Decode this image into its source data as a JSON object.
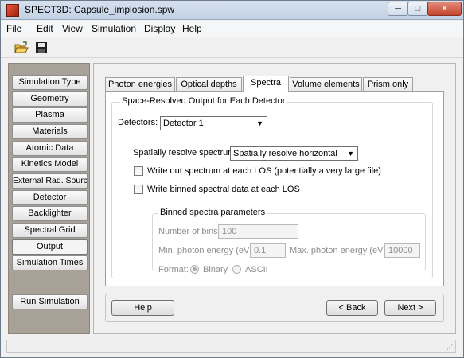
{
  "window": {
    "title": "SPECT3D:  Capsule_implosion.spw",
    "minimize_glyph": "─",
    "maximize_glyph": "□",
    "close_glyph": "✕"
  },
  "menu": {
    "items": [
      {
        "hotkey": "F",
        "rest": "ile"
      },
      {
        "hotkey": "E",
        "rest": "dit"
      },
      {
        "hotkey": "V",
        "rest": "iew"
      },
      {
        "pre": "Si",
        "hotkey": "m",
        "rest": "ulation"
      },
      {
        "hotkey": "D",
        "rest": "isplay"
      },
      {
        "hotkey": "H",
        "rest": "elp"
      }
    ]
  },
  "toolbar": {
    "icons": [
      "open-folder-icon",
      "save-disk-icon"
    ]
  },
  "sidebar": {
    "items": [
      "Simulation Type",
      "Geometry",
      "Plasma",
      "Materials",
      "Atomic Data",
      "Kinetics Model",
      "External Rad. Source",
      "Detector",
      "Backlighter",
      "Spectral Grid",
      "Output",
      "Simulation Times"
    ],
    "active": "Output",
    "run_label": "Run Simulation"
  },
  "tabs": {
    "items": [
      "Photon energies",
      "Optical depths",
      "Spectra",
      "Volume elements",
      "Prism only"
    ],
    "active": "Spectra"
  },
  "spectra": {
    "group_title": "Space-Resolved Output for Each Detector",
    "detectors_label": "Detectors:",
    "detectors_value": "Detector 1",
    "resolve_label": "Spatially resolve spectrum:",
    "resolve_value": "Spatially resolve horizontal",
    "write_los_label": "Write out spectrum at each LOS (potentially a very large file)",
    "write_los_checked": false,
    "write_binned_label": "Write binned spectral data at each LOS",
    "write_binned_checked": false,
    "binned": {
      "title": "Binned spectra parameters",
      "num_bins_label": "Number of bins:",
      "num_bins_value": "100",
      "min_label": "Min. photon energy (eV):",
      "min_value": "0.1",
      "max_label": "Max. photon energy (eV):",
      "max_value": "10000",
      "format_label": "Format:",
      "format_options": [
        "Binary",
        "ASCII"
      ],
      "format_selected": "Binary"
    }
  },
  "buttons": {
    "help": "Help",
    "back": "< Back",
    "next": "Next >"
  },
  "colors": {
    "sidebar_bg": "#a8a198",
    "titlebar": "#c2d1e4",
    "close_button": "#c2442e"
  }
}
